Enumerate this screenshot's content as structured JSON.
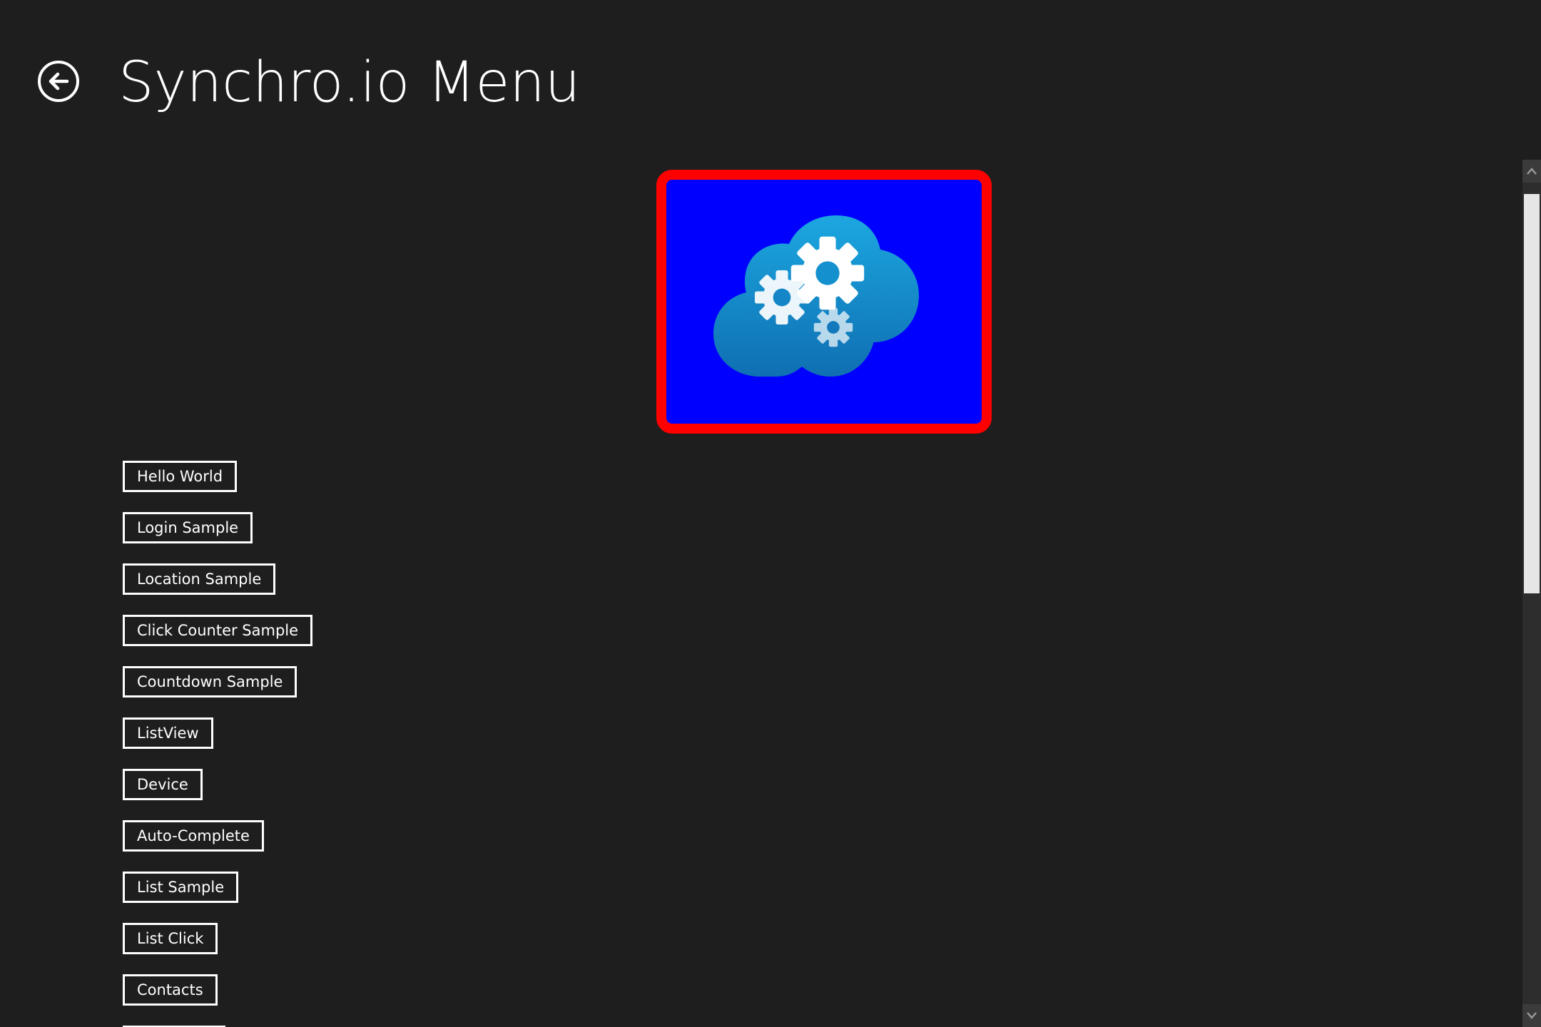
{
  "header": {
    "title": "Synchro.io Menu",
    "back_icon": "back-arrow-icon"
  },
  "logo": {
    "icon": "cloud-gears-icon",
    "background_color": "#0000ff",
    "border_color": "#ff0000"
  },
  "menu": {
    "items": [
      {
        "label": "Hello World"
      },
      {
        "label": "Login Sample"
      },
      {
        "label": "Location Sample"
      },
      {
        "label": "Click Counter Sample"
      },
      {
        "label": "Countdown Sample"
      },
      {
        "label": "ListView"
      },
      {
        "label": "Device"
      },
      {
        "label": "Auto-Complete"
      },
      {
        "label": "List Sample"
      },
      {
        "label": "List Click"
      },
      {
        "label": "Contacts"
      },
      {
        "label": ""
      }
    ]
  },
  "scrollbar": {
    "position_fraction": 0.0,
    "visible_fraction": 0.5
  }
}
